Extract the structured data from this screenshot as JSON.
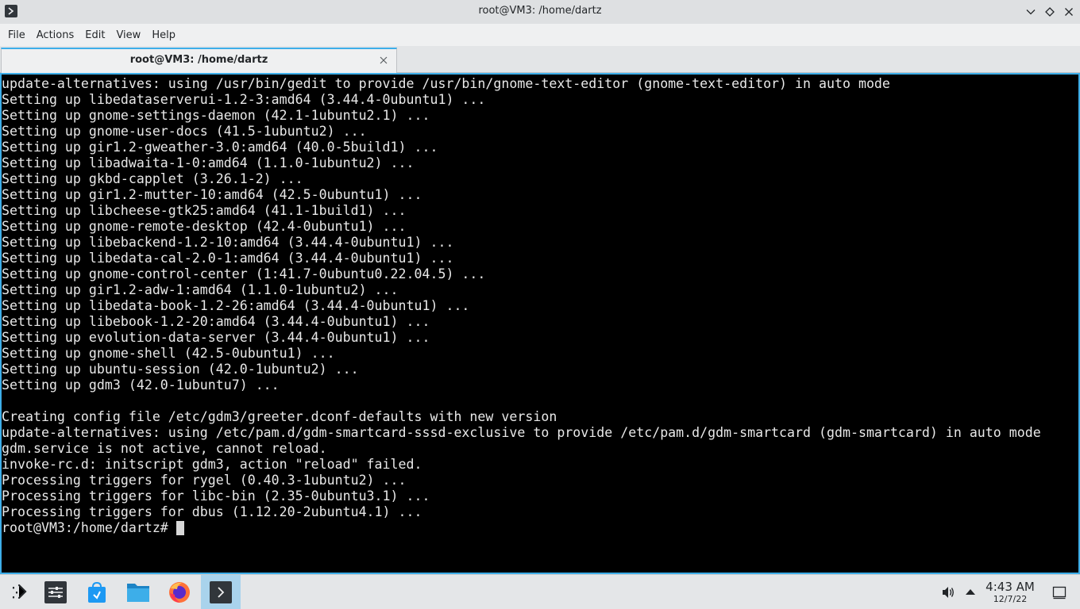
{
  "window": {
    "title": "root@VM3: /home/dartz"
  },
  "menubar": {
    "items": [
      "File",
      "Actions",
      "Edit",
      "View",
      "Help"
    ]
  },
  "tabs": [
    {
      "label": "root@VM3: /home/dartz"
    }
  ],
  "terminal": {
    "lines": [
      "update-alternatives: using /usr/bin/gedit to provide /usr/bin/gnome-text-editor (gnome-text-editor) in auto mode",
      "Setting up libedataserverui-1.2-3:amd64 (3.44.4-0ubuntu1) ...",
      "Setting up gnome-settings-daemon (42.1-1ubuntu2.1) ...",
      "Setting up gnome-user-docs (41.5-1ubuntu2) ...",
      "Setting up gir1.2-gweather-3.0:amd64 (40.0-5build1) ...",
      "Setting up libadwaita-1-0:amd64 (1.1.0-1ubuntu2) ...",
      "Setting up gkbd-capplet (3.26.1-2) ...",
      "Setting up gir1.2-mutter-10:amd64 (42.5-0ubuntu1) ...",
      "Setting up libcheese-gtk25:amd64 (41.1-1build1) ...",
      "Setting up gnome-remote-desktop (42.4-0ubuntu1) ...",
      "Setting up libebackend-1.2-10:amd64 (3.44.4-0ubuntu1) ...",
      "Setting up libedata-cal-2.0-1:amd64 (3.44.4-0ubuntu1) ...",
      "Setting up gnome-control-center (1:41.7-0ubuntu0.22.04.5) ...",
      "Setting up gir1.2-adw-1:amd64 (1.1.0-1ubuntu2) ...",
      "Setting up libedata-book-1.2-26:amd64 (3.44.4-0ubuntu1) ...",
      "Setting up libebook-1.2-20:amd64 (3.44.4-0ubuntu1) ...",
      "Setting up evolution-data-server (3.44.4-0ubuntu1) ...",
      "Setting up gnome-shell (42.5-0ubuntu1) ...",
      "Setting up ubuntu-session (42.0-1ubuntu2) ...",
      "Setting up gdm3 (42.0-1ubuntu7) ...",
      "",
      "Creating config file /etc/gdm3/greeter.dconf-defaults with new version",
      "update-alternatives: using /etc/pam.d/gdm-smartcard-sssd-exclusive to provide /etc/pam.d/gdm-smartcard (gdm-smartcard) in auto mode",
      "gdm.service is not active, cannot reload.",
      "invoke-rc.d: initscript gdm3, action \"reload\" failed.",
      "Processing triggers for rygel (0.40.3-1ubuntu2) ...",
      "Processing triggers for libc-bin (2.35-0ubuntu3.1) ...",
      "Processing triggers for dbus (1.12.20-2ubuntu4.1) ..."
    ],
    "prompt": "root@VM3:/home/dartz#"
  },
  "taskbar": {
    "items": [
      {
        "icon": "application-launcher-icon"
      },
      {
        "icon": "settings-icon"
      },
      {
        "icon": "software-store-icon"
      },
      {
        "icon": "file-manager-icon"
      },
      {
        "icon": "firefox-icon"
      },
      {
        "icon": "terminal-icon",
        "active": true
      }
    ],
    "clock": {
      "time": "4:43 AM",
      "date": "12/7/22"
    }
  },
  "colors": {
    "accent": "#3daee9",
    "terminal_bg": "#000000",
    "terminal_fg": "#e8e8e8",
    "active_task": "#a9d3ec"
  }
}
